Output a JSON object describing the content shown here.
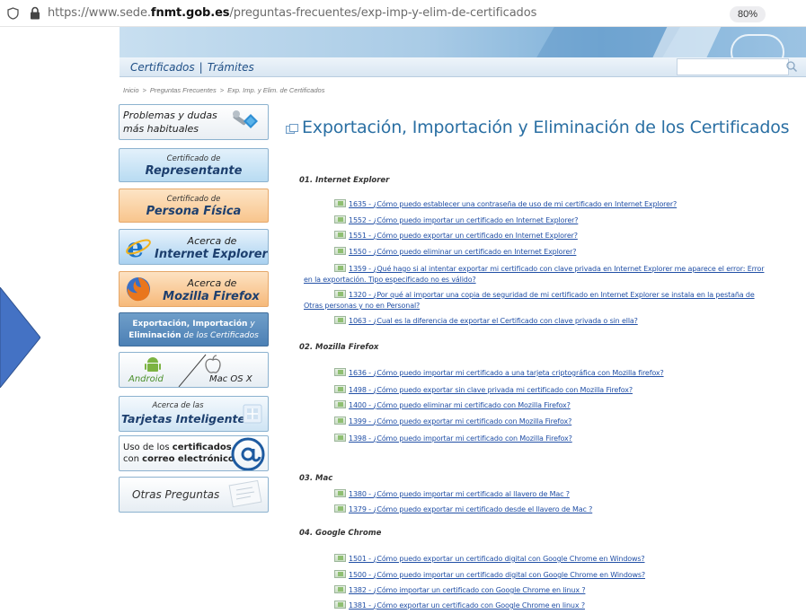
{
  "browser": {
    "url_prefix": "https://www.sede.",
    "url_domain": "fnmt.gob.es",
    "url_path": "/preguntas-frecuentes/exp-imp-y-elim-de-certificados",
    "zoom": "80%"
  },
  "nav": {
    "certificados": "Certificados",
    "separator": "|",
    "tramites": "Trámites",
    "search_placeholder": ""
  },
  "breadcrumb": [
    "Inicio",
    "Preguntas Frecuentes",
    "Exp. Imp. y Elim. de Certificados"
  ],
  "breadcrumb_sep": ">",
  "sidebar": {
    "problemas_l1": "Problemas y dudas",
    "problemas_l2": "más habituales",
    "representante_l1": "Certificado de",
    "representante_l2": "Representante",
    "persona_l1": "Certificado de",
    "persona_l2": "Persona Física",
    "ie_l1": "Acerca de",
    "ie_l2": "Internet Explorer",
    "ff_l1": "Acerca de",
    "ff_l2": "Mozilla Firefox",
    "exp_l1a": "Exportación, Importación",
    "exp_l1b": " y",
    "exp_l2a": "Eliminación",
    "exp_l2b": " de los Certificados",
    "android": "Android",
    "mac": "Mac OS X",
    "tarjetas_l1": "Acerca de las",
    "tarjetas_l2": "Tarjetas Inteligentes",
    "uso_l1a": "Uso de los ",
    "uso_l1b": "certificados",
    "uso_l2a": "con ",
    "uso_l2b": "correo electrónico",
    "otras": "Otras Preguntas"
  },
  "main": {
    "title": "Exportación, Importación y Eliminación de los Certificados",
    "sections": [
      {
        "heading": "01. Internet Explorer",
        "questions": [
          "1635 - ¿Cómo puedo establecer una contraseña de uso de mi certificado en Internet Explorer?",
          "1552 - ¿Cómo puedo importar un certificado en Internet Explorer?",
          "1551 - ¿Cómo puedo exportar un certificado en Internet Explorer?",
          "1550 - ¿Cómo puedo eliminar un certificado en Internet Explorer?",
          "1359 - ¿Qué hago si al intentar exportar mi certificado con clave privada en Internet Explorer me aparece el error: Error",
          "en la exportación. Tipo especificado no es válido?",
          "1320 - ¿Por qué al importar una copia de seguridad de mi certificado en Internet Explorer se instala en la pestaña de",
          "Otras personas y no en Personal?",
          "1063 - ¿Cual es la diferencia de exportar el Certificado con clave privada o sin ella?"
        ]
      },
      {
        "heading": "02. Mozilla Firefox",
        "questions": [
          "1636 - ¿Cómo puedo importar mi certificado a una tarjeta criptográfica con Mozilla firefox?",
          "1498 - ¿Cómo puedo exportar sin clave privada mi certificado con Mozilla Firefox?",
          "1400 - ¿Cómo puedo eliminar mi certificado con Mozilla Firefox?",
          "1399 - ¿Cómo puedo exportar mi certificado con Mozilla Firefox?",
          "1398 - ¿Cómo puedo importar mi certificado con Mozilla Firefox?"
        ]
      },
      {
        "heading": "03. Mac",
        "questions": [
          "1380 - ¿Cómo puedo importar mi certificado al llavero de Mac ?",
          "1379 - ¿Cómo puedo exportar mi certificado desde el llavero de Mac ?"
        ]
      },
      {
        "heading": "04. Google Chrome",
        "questions": [
          "1501 - ¿Cómo puedo exportar un certificado digital con Google Chrome en Windows?",
          "1500 - ¿Cómo puedo importar un certificado digital con Google Chrome en Windows?",
          "1382 - ¿Cómo importar un certificado con Google Chrome en linux ?",
          "1381 - ¿Cómo exportar un certificado con Google Chrome en linux ?"
        ]
      }
    ]
  },
  "colors": {
    "link": "#2250a6",
    "title": "#2a6fa3",
    "arrow": "#4472c4"
  }
}
